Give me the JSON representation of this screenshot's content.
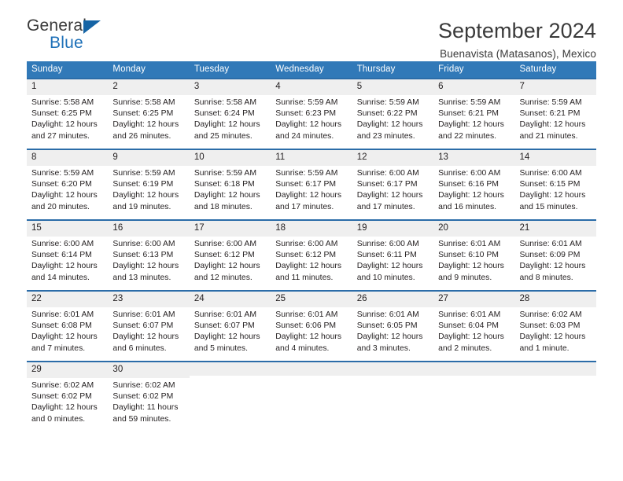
{
  "brand": {
    "name_top": "General",
    "name_bottom": "Blue",
    "triangle_color": "#1564a5",
    "blue": "#1d70b8"
  },
  "header": {
    "title": "September 2024",
    "subtitle": "Buenavista (Matasanos), Mexico"
  },
  "theme": {
    "header_row_bg": "#3179b8",
    "grid_border": "#2b6ca8",
    "daynum_bg": "#efefef",
    "text": "#231f20"
  },
  "calendar": {
    "weekday_headers": [
      "Sunday",
      "Monday",
      "Tuesday",
      "Wednesday",
      "Thursday",
      "Friday",
      "Saturday"
    ],
    "labels": {
      "sunrise_prefix": "Sunrise:",
      "sunset_prefix": "Sunset:",
      "daylight_prefix": "Daylight:"
    },
    "weeks": [
      [
        {
          "day": "1",
          "sunrise": "Sunrise: 5:58 AM",
          "sunset": "Sunset: 6:25 PM",
          "daylight": "Daylight: 12 hours and 27 minutes."
        },
        {
          "day": "2",
          "sunrise": "Sunrise: 5:58 AM",
          "sunset": "Sunset: 6:25 PM",
          "daylight": "Daylight: 12 hours and 26 minutes."
        },
        {
          "day": "3",
          "sunrise": "Sunrise: 5:58 AM",
          "sunset": "Sunset: 6:24 PM",
          "daylight": "Daylight: 12 hours and 25 minutes."
        },
        {
          "day": "4",
          "sunrise": "Sunrise: 5:59 AM",
          "sunset": "Sunset: 6:23 PM",
          "daylight": "Daylight: 12 hours and 24 minutes."
        },
        {
          "day": "5",
          "sunrise": "Sunrise: 5:59 AM",
          "sunset": "Sunset: 6:22 PM",
          "daylight": "Daylight: 12 hours and 23 minutes."
        },
        {
          "day": "6",
          "sunrise": "Sunrise: 5:59 AM",
          "sunset": "Sunset: 6:21 PM",
          "daylight": "Daylight: 12 hours and 22 minutes."
        },
        {
          "day": "7",
          "sunrise": "Sunrise: 5:59 AM",
          "sunset": "Sunset: 6:21 PM",
          "daylight": "Daylight: 12 hours and 21 minutes."
        }
      ],
      [
        {
          "day": "8",
          "sunrise": "Sunrise: 5:59 AM",
          "sunset": "Sunset: 6:20 PM",
          "daylight": "Daylight: 12 hours and 20 minutes."
        },
        {
          "day": "9",
          "sunrise": "Sunrise: 5:59 AM",
          "sunset": "Sunset: 6:19 PM",
          "daylight": "Daylight: 12 hours and 19 minutes."
        },
        {
          "day": "10",
          "sunrise": "Sunrise: 5:59 AM",
          "sunset": "Sunset: 6:18 PM",
          "daylight": "Daylight: 12 hours and 18 minutes."
        },
        {
          "day": "11",
          "sunrise": "Sunrise: 5:59 AM",
          "sunset": "Sunset: 6:17 PM",
          "daylight": "Daylight: 12 hours and 17 minutes."
        },
        {
          "day": "12",
          "sunrise": "Sunrise: 6:00 AM",
          "sunset": "Sunset: 6:17 PM",
          "daylight": "Daylight: 12 hours and 17 minutes."
        },
        {
          "day": "13",
          "sunrise": "Sunrise: 6:00 AM",
          "sunset": "Sunset: 6:16 PM",
          "daylight": "Daylight: 12 hours and 16 minutes."
        },
        {
          "day": "14",
          "sunrise": "Sunrise: 6:00 AM",
          "sunset": "Sunset: 6:15 PM",
          "daylight": "Daylight: 12 hours and 15 minutes."
        }
      ],
      [
        {
          "day": "15",
          "sunrise": "Sunrise: 6:00 AM",
          "sunset": "Sunset: 6:14 PM",
          "daylight": "Daylight: 12 hours and 14 minutes."
        },
        {
          "day": "16",
          "sunrise": "Sunrise: 6:00 AM",
          "sunset": "Sunset: 6:13 PM",
          "daylight": "Daylight: 12 hours and 13 minutes."
        },
        {
          "day": "17",
          "sunrise": "Sunrise: 6:00 AM",
          "sunset": "Sunset: 6:12 PM",
          "daylight": "Daylight: 12 hours and 12 minutes."
        },
        {
          "day": "18",
          "sunrise": "Sunrise: 6:00 AM",
          "sunset": "Sunset: 6:12 PM",
          "daylight": "Daylight: 12 hours and 11 minutes."
        },
        {
          "day": "19",
          "sunrise": "Sunrise: 6:00 AM",
          "sunset": "Sunset: 6:11 PM",
          "daylight": "Daylight: 12 hours and 10 minutes."
        },
        {
          "day": "20",
          "sunrise": "Sunrise: 6:01 AM",
          "sunset": "Sunset: 6:10 PM",
          "daylight": "Daylight: 12 hours and 9 minutes."
        },
        {
          "day": "21",
          "sunrise": "Sunrise: 6:01 AM",
          "sunset": "Sunset: 6:09 PM",
          "daylight": "Daylight: 12 hours and 8 minutes."
        }
      ],
      [
        {
          "day": "22",
          "sunrise": "Sunrise: 6:01 AM",
          "sunset": "Sunset: 6:08 PM",
          "daylight": "Daylight: 12 hours and 7 minutes."
        },
        {
          "day": "23",
          "sunrise": "Sunrise: 6:01 AM",
          "sunset": "Sunset: 6:07 PM",
          "daylight": "Daylight: 12 hours and 6 minutes."
        },
        {
          "day": "24",
          "sunrise": "Sunrise: 6:01 AM",
          "sunset": "Sunset: 6:07 PM",
          "daylight": "Daylight: 12 hours and 5 minutes."
        },
        {
          "day": "25",
          "sunrise": "Sunrise: 6:01 AM",
          "sunset": "Sunset: 6:06 PM",
          "daylight": "Daylight: 12 hours and 4 minutes."
        },
        {
          "day": "26",
          "sunrise": "Sunrise: 6:01 AM",
          "sunset": "Sunset: 6:05 PM",
          "daylight": "Daylight: 12 hours and 3 minutes."
        },
        {
          "day": "27",
          "sunrise": "Sunrise: 6:01 AM",
          "sunset": "Sunset: 6:04 PM",
          "daylight": "Daylight: 12 hours and 2 minutes."
        },
        {
          "day": "28",
          "sunrise": "Sunrise: 6:02 AM",
          "sunset": "Sunset: 6:03 PM",
          "daylight": "Daylight: 12 hours and 1 minute."
        }
      ],
      [
        {
          "day": "29",
          "sunrise": "Sunrise: 6:02 AM",
          "sunset": "Sunset: 6:02 PM",
          "daylight": "Daylight: 12 hours and 0 minutes."
        },
        {
          "day": "30",
          "sunrise": "Sunrise: 6:02 AM",
          "sunset": "Sunset: 6:02 PM",
          "daylight": "Daylight: 11 hours and 59 minutes."
        },
        {
          "day": "",
          "sunrise": "",
          "sunset": "",
          "daylight": ""
        },
        {
          "day": "",
          "sunrise": "",
          "sunset": "",
          "daylight": ""
        },
        {
          "day": "",
          "sunrise": "",
          "sunset": "",
          "daylight": ""
        },
        {
          "day": "",
          "sunrise": "",
          "sunset": "",
          "daylight": ""
        },
        {
          "day": "",
          "sunrise": "",
          "sunset": "",
          "daylight": ""
        }
      ]
    ]
  }
}
